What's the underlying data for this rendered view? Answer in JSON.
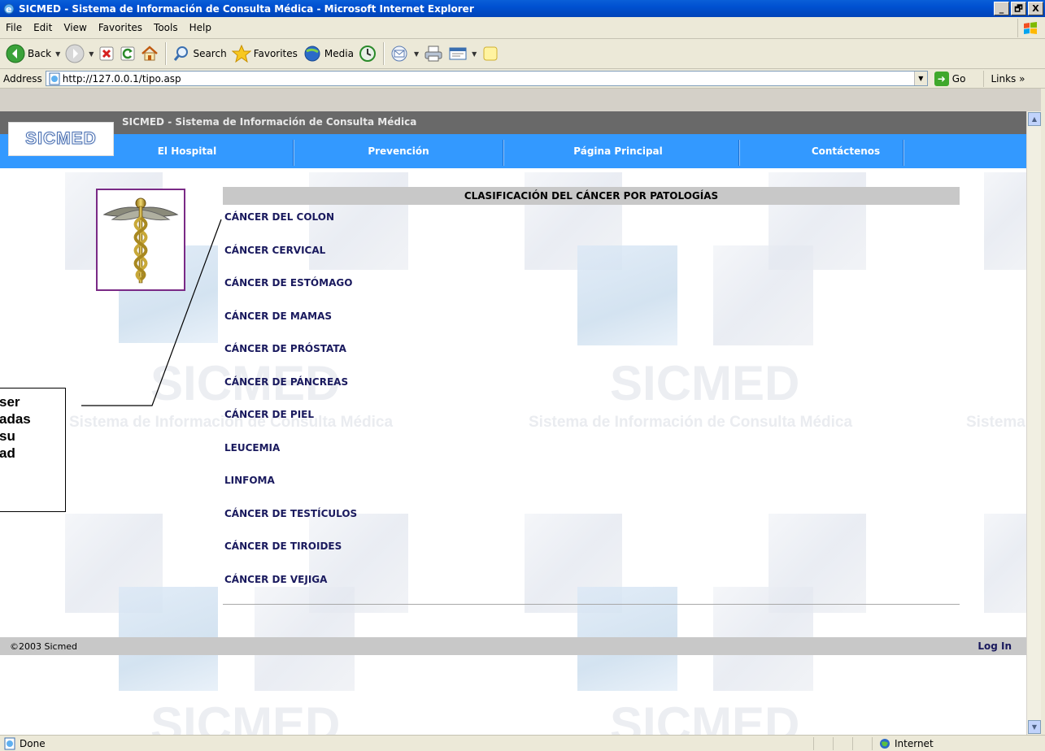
{
  "window": {
    "title": "SICMED - Sistema de Información de Consulta Médica - Microsoft Internet Explorer",
    "minimize": "_",
    "maximize": "🗗",
    "close": "X"
  },
  "menu": [
    "File",
    "Edit",
    "View",
    "Favorites",
    "Tools",
    "Help"
  ],
  "toolbar": {
    "back": "Back",
    "search": "Search",
    "favorites": "Favorites",
    "media": "Media"
  },
  "address": {
    "label": "Address",
    "url": "http://127.0.0.1/tipo.asp",
    "go": "Go",
    "links": "Links »"
  },
  "page": {
    "header_title": "SICMED - Sistema de Información de Consulta Médica",
    "logo_text": "SICMED",
    "nav": [
      "El Hospital",
      "Prevención",
      "Página Principal",
      "Contáctenos"
    ],
    "section_title": "CLASIFICACIÓN DEL CÁNCER POR PATOLOGÍAS",
    "cancer_types": [
      "CÁNCER DEL COLON",
      "CÁNCER CERVICAL",
      "CÁNCER DE ESTÓMAGO",
      "CÁNCER DE MAMAS",
      "CÁNCER DE PRÓSTATA",
      "CÁNCER DE PÁNCREAS",
      "CÁNCER DE PIEL",
      "LEUCEMIA",
      "LINFOMA",
      "CÁNCER DE TESTÍCULOS",
      "CÁNCER DE TIROIDES",
      "CÁNCER DE VEJIGA"
    ],
    "watermark_big": "SICMED",
    "watermark_small": "Sistema de Información de Consulta Médica",
    "watermark_small_cut": "Sistema",
    "copyright": "©2003 Sicmed",
    "login": "Log In"
  },
  "callout": {
    "lines": [
      "ser",
      "adas",
      "su",
      "ad"
    ]
  },
  "status": {
    "text": "Done",
    "zone": "Internet"
  },
  "colors": {
    "title_bar": "#0050d0",
    "nav_blue": "#3399ff",
    "header_gray": "#696969",
    "link_navy": "#1a1a5e",
    "caduceus_border": "#7a2a86"
  }
}
